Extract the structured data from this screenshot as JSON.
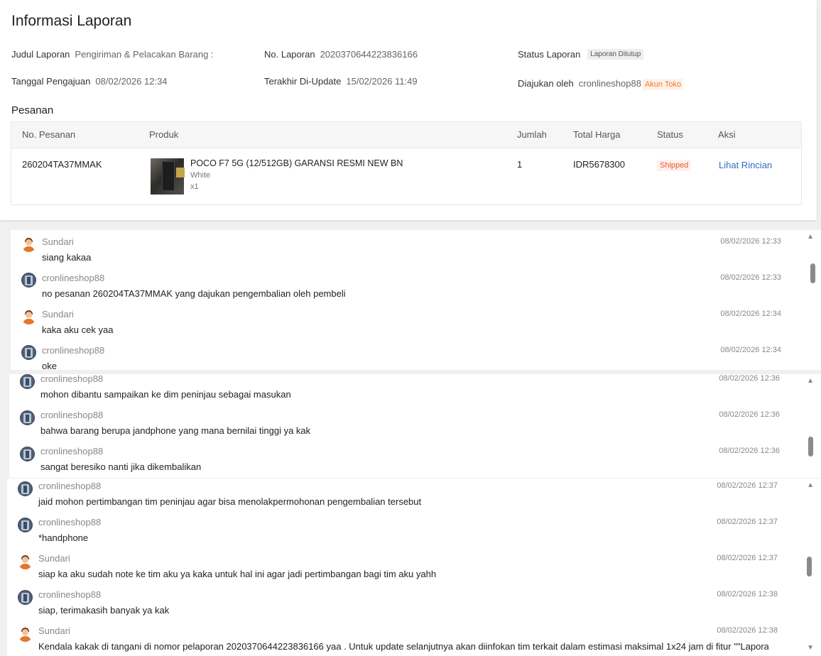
{
  "report": {
    "title": "Informasi Laporan",
    "judul_label": "Judul Laporan",
    "judul_value": "Pengiriman & Pelacakan Barang :",
    "no_label": "No. Laporan",
    "no_value": "2020370644223836166",
    "status_label": "Status Laporan",
    "status_value": "Laporan Ditutup",
    "tanggal_label": "Tanggal Pengajuan",
    "tanggal_value": "08/02/2026 12:34",
    "update_label": "Terakhir Di-Update",
    "update_value": "15/02/2026 11:49",
    "diajukan_label": "Diajukan oleh",
    "diajukan_value": "cronlineshop88",
    "diajukan_badge": "Akun Toko"
  },
  "orders": {
    "section_title": "Pesanan",
    "columns": [
      "No. Pesanan",
      "Produk",
      "Jumlah",
      "Total Harga",
      "Status",
      "Aksi"
    ],
    "row": {
      "order_no": "260204TA37MMAK",
      "product_name": "POCO F7 5G (12/512GB) GARANSI RESMI NEW BN...",
      "variant": "White",
      "qty_label": "x1",
      "jumlah": "1",
      "total": "IDR5678300",
      "status": "Shipped",
      "action": "Lihat Rincian"
    }
  },
  "chat_panels": [
    {
      "messages": [
        {
          "sender": "Sundari",
          "avatar": "sundari-avatar",
          "time": "08/02/2026 12:33",
          "text": "siang kakaa"
        },
        {
          "sender": "cronlineshop88",
          "avatar": "shop-avatar",
          "time": "08/02/2026 12:33",
          "text": "no pesanan 260204TA37MMAK yang dajukan pengembalian oleh pembeli"
        },
        {
          "sender": "Sundari",
          "avatar": "sundari-avatar",
          "time": "08/02/2026 12:34",
          "text": "kaka aku cek yaa"
        },
        {
          "sender": "cronlineshop88",
          "avatar": "shop-avatar",
          "time": "08/02/2026 12:34",
          "text": "oke"
        }
      ]
    },
    {
      "messages": [
        {
          "sender": "cronlineshop88",
          "avatar": "shop-avatar",
          "time": "08/02/2026 12:36",
          "text": "mohon dibantu sampaikan ke dim peninjau sebagai masukan"
        },
        {
          "sender": "cronlineshop88",
          "avatar": "shop-avatar",
          "time": "08/02/2026 12:36",
          "text": "bahwa barang berupa jandphone yang mana bernilai tinggi ya kak"
        },
        {
          "sender": "cronlineshop88",
          "avatar": "shop-avatar",
          "time": "08/02/2026 12:36",
          "text": "sangat beresiko nanti jika dikembalikan"
        }
      ]
    },
    {
      "messages": [
        {
          "sender": "cronlineshop88",
          "avatar": "shop-avatar",
          "time": "08/02/2026 12:37",
          "text": "jaid mohon pertimbangan tim peninjau agar bisa menolakpermohonan pengembalian tersebut"
        },
        {
          "sender": "cronlineshop88",
          "avatar": "shop-avatar",
          "time": "08/02/2026 12:37",
          "text": "*handphone"
        },
        {
          "sender": "Sundari",
          "avatar": "sundari-avatar",
          "time": "08/02/2026 12:37",
          "text": "siap ka aku sudah note ke tim aku ya kaka untuk hal ini agar jadi pertimbangan bagi tim aku yahh"
        },
        {
          "sender": "cronlineshop88",
          "avatar": "shop-avatar",
          "time": "08/02/2026 12:38",
          "text": "siap, terimakasih banyak ya kak"
        },
        {
          "sender": "Sundari",
          "avatar": "sundari-avatar",
          "time": "08/02/2026 12:38",
          "text": "Kendala kakak di tangani di nomor pelaporan 2020370644223836166 yaa . Untuk update selanjutnya akan diinfokan tim terkait dalam estimasi maksimal 1x24 jam di fitur \"\"Laporan Say"
        }
      ]
    }
  ],
  "icons": {
    "scroll_up": "▲",
    "scroll_down": "▼"
  }
}
